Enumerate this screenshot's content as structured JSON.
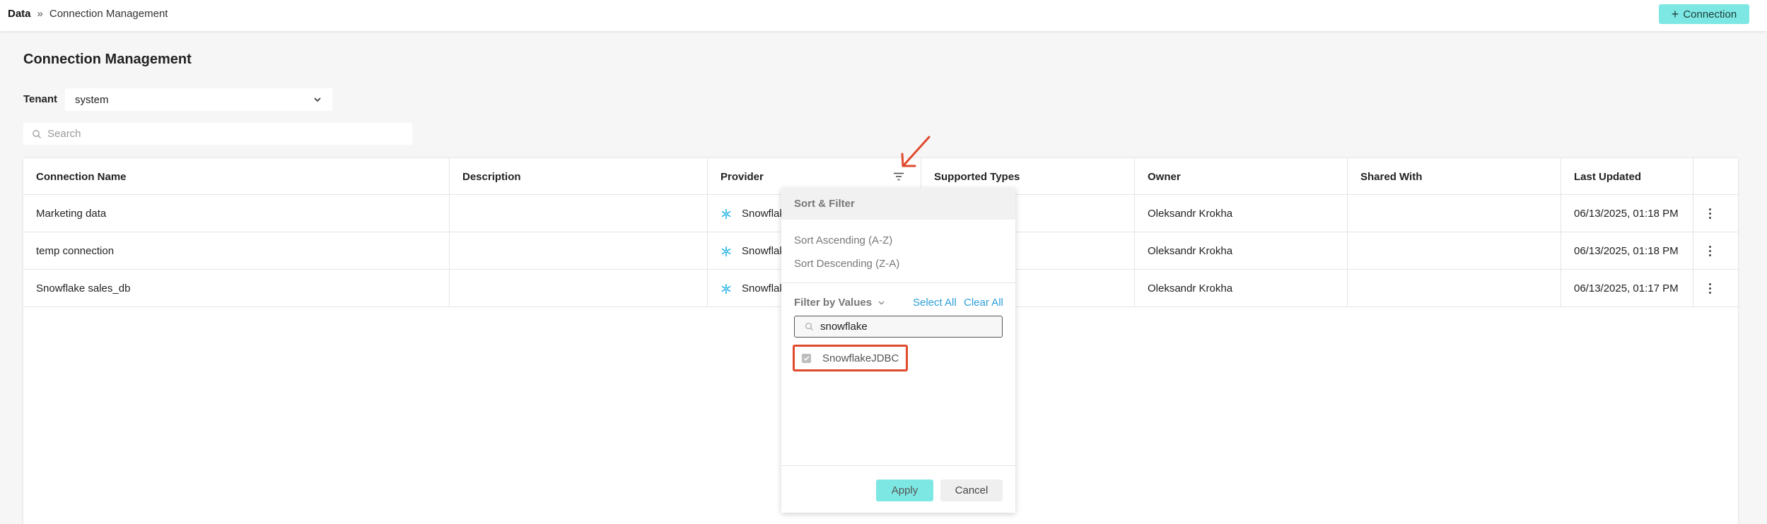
{
  "breadcrumb": {
    "root": "Data",
    "separator": "»",
    "current": "Connection Management"
  },
  "header": {
    "add_button_label": "Connection",
    "add_button_icon": "plus-icon"
  },
  "page": {
    "title": "Connection Management"
  },
  "tenant": {
    "label": "Tenant",
    "value": "system"
  },
  "search": {
    "placeholder": "Search",
    "value": ""
  },
  "table": {
    "columns": [
      "Connection Name",
      "Description",
      "Provider",
      "Supported Types",
      "Owner",
      "Shared With",
      "Last Updated"
    ],
    "rows": [
      {
        "name": "Marketing data",
        "description": "",
        "provider": "Snowflake",
        "supported_types": "",
        "owner": "Oleksandr Krokha",
        "shared_with": "",
        "last_updated": "06/13/2025, 01:18 PM"
      },
      {
        "name": "temp connection",
        "description": "",
        "provider": "Snowflake",
        "supported_types": "",
        "owner": "Oleksandr Krokha",
        "shared_with": "",
        "last_updated": "06/13/2025, 01:18 PM"
      },
      {
        "name": "Snowflake sales_db",
        "description": "",
        "provider": "Snowflake",
        "supported_types": "",
        "owner": "Oleksandr Krokha",
        "shared_with": "",
        "last_updated": "06/13/2025, 01:17 PM"
      }
    ]
  },
  "filter_popup": {
    "title": "Sort & Filter",
    "sort_ascending": "Sort Ascending (A-Z)",
    "sort_descending": "Sort Descending (Z-A)",
    "filter_by_values": "Filter by Values",
    "select_all": "Select All",
    "clear_all": "Clear All",
    "search_value": "snowflake",
    "options": [
      {
        "label": "SnowflakeJDBC",
        "checked": true
      }
    ],
    "apply_label": "Apply",
    "cancel_label": "Cancel"
  },
  "colors": {
    "accent": "#7de8e3",
    "link": "#2d9fd8",
    "highlight": "#e04a2d",
    "provider_icon": "#29b5e8"
  }
}
